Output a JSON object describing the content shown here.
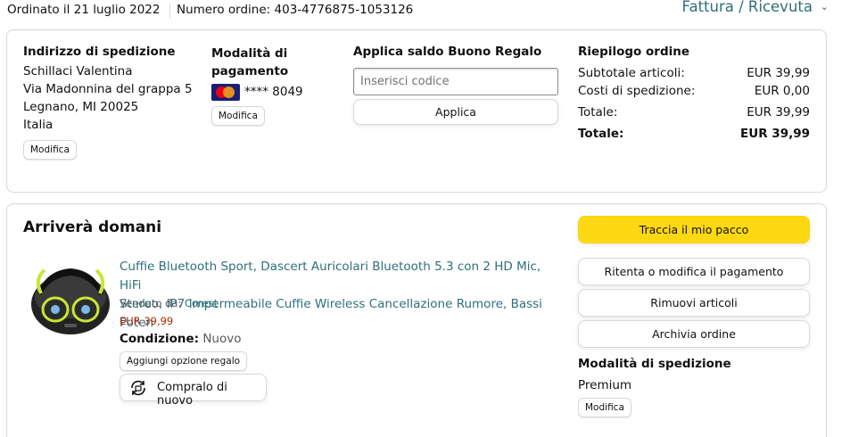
{
  "header": {
    "order_date": "Ordinato il 21 luglio 2022",
    "order_number": "Numero ordine: 403-4776875-1053126",
    "invoice_label": "Fattura / Ricevuta",
    "invoice_chevron": "chevron-down-icon"
  },
  "shipping_address": {
    "title": "Indirizzo di spedizione",
    "lines": [
      "Schillaci Valentina",
      "Via Madonnina del grappa 5",
      "Legnano, MI 20025",
      "Italia"
    ],
    "edit_label": "Modifica"
  },
  "payment": {
    "title_line1": "Modalità di",
    "title_line2": "pagamento",
    "card_icon": "mastercard-icon",
    "card_digits": "**** 8049",
    "edit_label": "Modifica"
  },
  "gift_card": {
    "title": "Applica saldo Buono Regalo",
    "input_placeholder": "Inserisci codice",
    "input_value": "",
    "apply_label": "Applica"
  },
  "summary": {
    "title": "Riepilogo ordine",
    "rows": [
      {
        "label": "Subtotale articoli:",
        "value": "EUR 39,99"
      },
      {
        "label": "Costi di spedizione:",
        "value": "EUR 0,00"
      },
      {
        "label": "Totale:",
        "value": "EUR 39,99"
      },
      {
        "label": "Totale:",
        "value": "EUR 39,99",
        "bold": true
      }
    ]
  },
  "shipment": {
    "title": "Arriverà domani",
    "product": {
      "image_icon": "earbuds-product-image",
      "title_line1": "Cuffie Bluetooth Sport, Dascert Auricolari Bluetooth 5.3 con 2 HD Mic, HiFi",
      "title_line2": "Stereo, IP7 Impermeabile Cuffie Wireless Cancellazione Rumore, Bassi Poten",
      "sold_by_label": "Venduto da:",
      "seller": "Corest",
      "price": "EUR 39,99",
      "condition_label": "Condizione:",
      "condition_value": "Nuovo",
      "gift_option_label": "Aggiungi opzione regalo",
      "rebuy_label": "Compralo di nuovo",
      "rebuy_icon": "rebuy-icon"
    },
    "actions": {
      "track": "Traccia il mio pacco",
      "retry_payment": "Ritenta o modifica il pagamento",
      "remove_items": "Rimuovi articoli",
      "archive": "Archivia ordine"
    },
    "shipping_mode": {
      "title": "Modalità di spedizione",
      "value": "Premium",
      "edit_label": "Modifica"
    }
  },
  "colors": {
    "link": "#2f6f7a",
    "price": "#b12704",
    "primary_button": "#ffd814",
    "border": "#d5d9d9"
  }
}
